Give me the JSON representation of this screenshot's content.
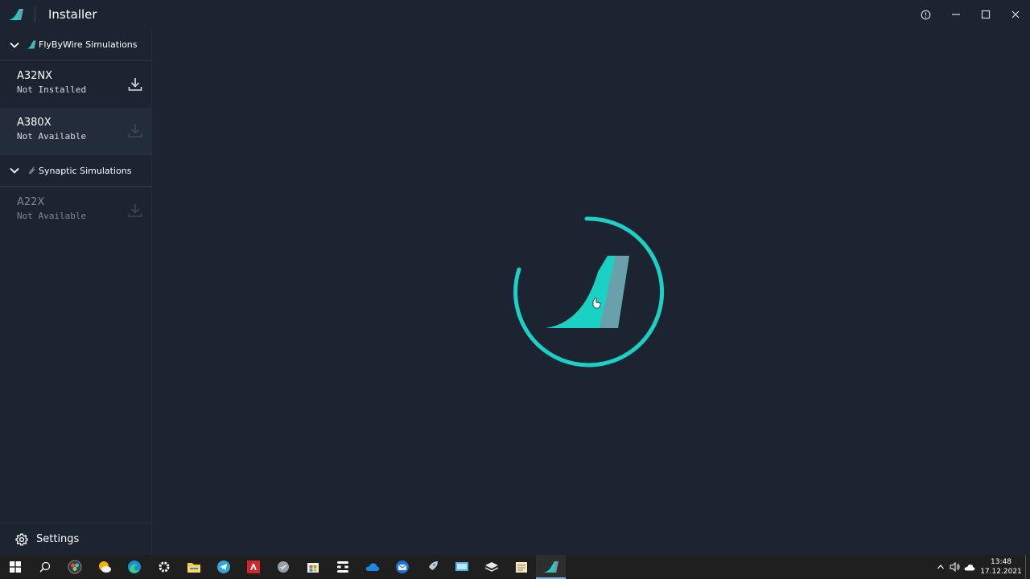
{
  "window": {
    "title": "Installer",
    "controls": [
      "info-icon",
      "minimize-icon",
      "maximize-icon",
      "close-icon"
    ]
  },
  "colors": {
    "accent": "#1ad1c4",
    "background": "#1b2430",
    "selected": "#222c3a"
  },
  "sidebar": {
    "publishers": [
      {
        "name": "FlyByWire Simulations",
        "icon": "flybywire-logo-icon",
        "addons": [
          {
            "name": "A32NX",
            "status": "Not Installed",
            "icon": "download-icon"
          },
          {
            "name": "A380X",
            "status": "Not Available",
            "icon": "download-icon"
          }
        ]
      },
      {
        "name": "Synaptic Simulations",
        "icon": "synaptic-logo-icon",
        "addons": [
          {
            "name": "A22X",
            "status": "Not Available",
            "icon": "download-icon"
          }
        ]
      }
    ],
    "settings_label": "Settings"
  },
  "taskbar": {
    "items": [
      "windows-start-icon",
      "search-icon",
      "davinci-icon",
      "weather-icon",
      "edge-icon",
      "settings-gear-icon",
      "file-explorer-icon",
      "telegram-icon",
      "amd-icon",
      "shield-app-icon",
      "store-icon",
      "mixer-icon",
      "onedrive-icon",
      "thunderbird-icon",
      "rocket-icon",
      "remote-desktop-icon",
      "layers-icon",
      "notepad-icon",
      "flybywire-installer-icon"
    ],
    "time": "13:48",
    "date": "17.12.2021"
  }
}
